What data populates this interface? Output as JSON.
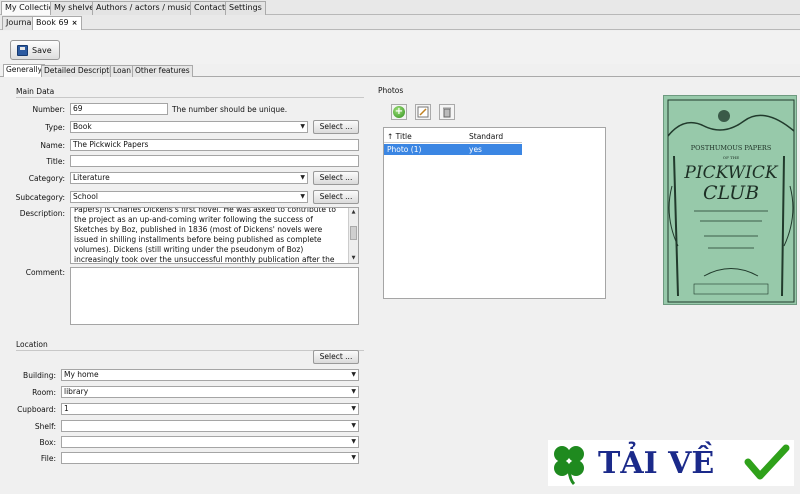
{
  "top_tabs": [
    "My Collection",
    "My shelves",
    "Authors / actors / musicians",
    "Contacts",
    "Settings"
  ],
  "sub_tabs": {
    "journal": "Journal",
    "book": "Book 69",
    "close": "×"
  },
  "toolbar": {
    "save_label": "Save"
  },
  "form_tabs": [
    "Generally",
    "Detailed Description",
    "Loan",
    "Other features"
  ],
  "main_data": {
    "title": "Main Data",
    "number_label": "Number:",
    "number_value": "69",
    "number_hint": "The number should be unique.",
    "type_label": "Type:",
    "type_value": "Book",
    "name_label": "Name:",
    "name_value": "The Pickwick Papers",
    "title_label": "Title:",
    "title_value": "",
    "category_label": "Category:",
    "category_value": "Literature",
    "subcategory_label": "Subcategory:",
    "subcategory_value": "School",
    "description_label": "Description:",
    "description_value": "Papers) is Charles Dickens's first novel. He was asked to contribute to the project as an up-and-coming writer following the success of Sketches by Boz, published in 1836 (most of Dickens' novels were issued in shilling installments before being published as complete volumes). Dickens (still writing under the pseudonym of Boz) increasingly took over the unsuccessful monthly publication after the original illustrator Robert Seymour had committed suicide.",
    "comment_label": "Comment:",
    "comment_value": "",
    "select_label": "Select ..."
  },
  "location": {
    "title": "Location",
    "select_label": "Select ...",
    "building_label": "Building:",
    "building_value": "My home",
    "room_label": "Room:",
    "room_value": "library",
    "cupboard_label": "Cupboard:",
    "cupboard_value": "1",
    "shelf_label": "Shelf:",
    "shelf_value": "",
    "box_label": "Box:",
    "box_value": "",
    "file_label": "File:",
    "file_value": ""
  },
  "photos": {
    "title": "Photos",
    "col_title": "↑ Title",
    "col_standard": "Standard",
    "rows": [
      {
        "title": "Photo (1)",
        "standard": "yes"
      }
    ]
  },
  "cover": {
    "line1": "POSTHUMOUS PAPERS",
    "line2": "OF THE",
    "line3": "PICKWICK",
    "line4": "CLUB"
  },
  "watermark": {
    "text": "TẢI VỀ"
  },
  "colors": {
    "selection": "#3b86e3",
    "logo_text": "#1b2a8a",
    "check": "#2fa11a",
    "clover": "#1f8a1f"
  }
}
